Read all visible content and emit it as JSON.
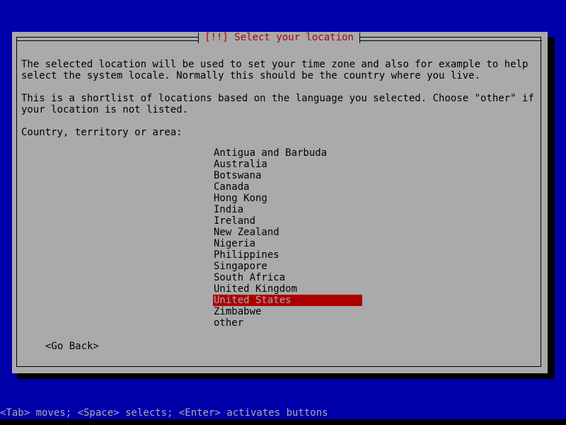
{
  "screen": {
    "background_color": "#0000aa",
    "text_color": "#aaaaaa"
  },
  "dialog": {
    "title": "[!!] Select your location",
    "title_color": "#aa0000",
    "background_color": "#aaaaaa",
    "paragraphs": [
      "The selected location will be used to set your time zone and also for example to help",
      "select the system locale. Normally this should be the country where you live.",
      "This is a shortlist of locations based on the language you selected. Choose \"other\" if",
      "your location is not listed."
    ],
    "list_label": "Country, territory or area:",
    "country_list": {
      "selected_index": 13,
      "selected_color": "#aa0000",
      "items": [
        "Antigua and Barbuda",
        "Australia",
        "Botswana",
        "Canada",
        "Hong Kong",
        "India",
        "Ireland",
        "New Zealand",
        "Nigeria",
        "Philippines",
        "Singapore",
        "South Africa",
        "United Kingdom",
        "United States",
        "Zimbabwe",
        "other"
      ]
    },
    "buttons": [
      {
        "label": "<Go Back>"
      }
    ]
  },
  "status_bar": {
    "text": "<Tab> moves; <Space> selects; <Enter> activates buttons"
  }
}
